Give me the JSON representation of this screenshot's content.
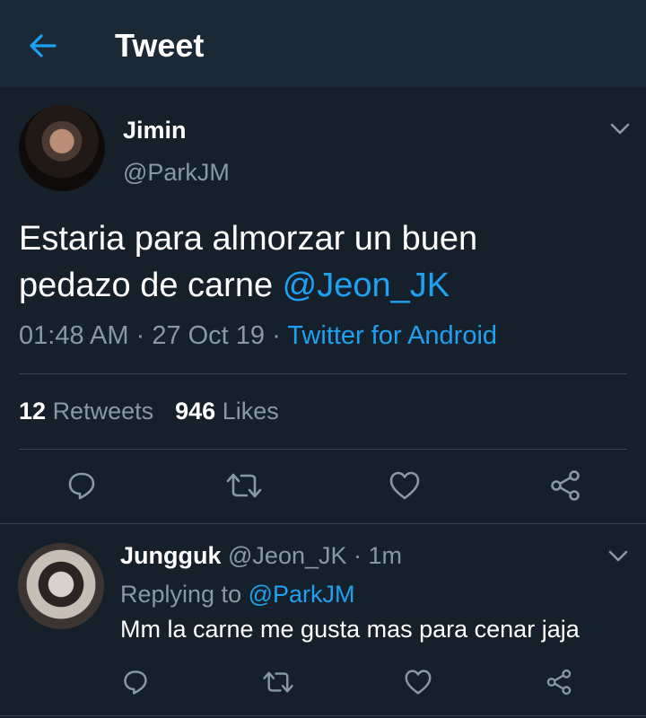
{
  "header": {
    "title": "Tweet"
  },
  "tweet": {
    "author_name": "Jimin",
    "author_handle": "@ParkJM",
    "text_line1": "Estaria para almorzar un buen",
    "text_line2_prefix": "pedazo de carne ",
    "text_mention": "@Jeon_JK",
    "time": "01:48 AM",
    "date": "27 Oct 19",
    "separator": " · ",
    "source": "Twitter for Android",
    "retweets_count": "12",
    "retweets_label": "Retweets",
    "likes_count": "946",
    "likes_label": "Likes"
  },
  "reply": {
    "author_name": "Jungguk",
    "author_handle": "@Jeon_JK",
    "time_ago": "1m",
    "replying_to_label": "Replying to",
    "replying_to_handle": "@ParkJM",
    "text": "Mm la carne me gusta mas para cenar jaja"
  },
  "icons": {
    "back": "arrow-left-icon",
    "chevron": "chevron-down-icon",
    "reply": "reply-icon",
    "retweet": "retweet-icon",
    "like": "heart-icon",
    "share": "share-icon"
  },
  "colors": {
    "background": "#15202b",
    "header": "#1b2836",
    "accent": "#1da1f2",
    "muted": "#8899a6",
    "divider": "#38444d"
  }
}
